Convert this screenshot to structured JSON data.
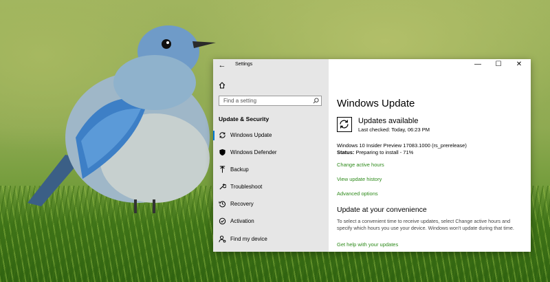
{
  "window": {
    "title": "Settings",
    "controls": {
      "minimize": "—",
      "maximize": "☐",
      "close": "✕"
    }
  },
  "sidebar": {
    "search_placeholder": "Find a setting",
    "section_heading": "Update & Security",
    "items": [
      {
        "label": "Windows Update",
        "icon": "sync-icon",
        "active": true
      },
      {
        "label": "Windows Defender",
        "icon": "shield-icon"
      },
      {
        "label": "Backup",
        "icon": "backup-arrow-icon"
      },
      {
        "label": "Troubleshoot",
        "icon": "wrench-icon"
      },
      {
        "label": "Recovery",
        "icon": "history-icon"
      },
      {
        "label": "Activation",
        "icon": "check-circle-icon"
      },
      {
        "label": "Find my device",
        "icon": "person-location-icon"
      }
    ]
  },
  "main": {
    "page_title": "Windows Update",
    "status_title": "Updates available",
    "last_checked": "Last checked: Today, 06:23 PM",
    "build_name": "Windows 10 Insider Preview 17083.1000 (rs_prerelease)",
    "status_label": "Status:",
    "status_value": "Preparing to install - 71%",
    "links": {
      "change_active_hours": "Change active hours",
      "view_update_history": "View update history",
      "advanced_options": "Advanced options"
    },
    "convenience_heading": "Update at your convenience",
    "convenience_text": "To select a convenient time to receive updates, select Change active hours and specify which hours you use your device. Windows won't update during that time.",
    "help_link": "Get help with your updates"
  },
  "colors": {
    "accent": "#0078d7",
    "link": "#2d8a1a",
    "sidebar_bg": "#e6e6e6"
  }
}
